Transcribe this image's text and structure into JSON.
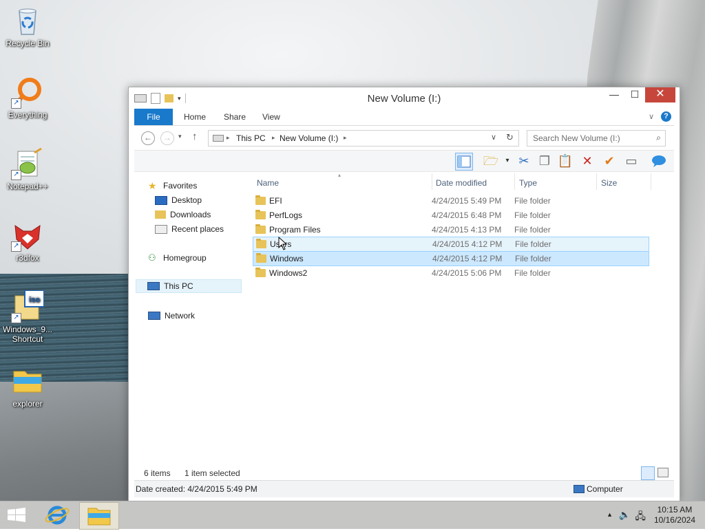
{
  "desktop": {
    "icons": [
      {
        "label": "Recycle Bin",
        "icon": "recycle-bin-icon"
      },
      {
        "label": "Everything",
        "icon": "everything-icon"
      },
      {
        "label": "Notepad++",
        "icon": "notepad-plus-plus-icon"
      },
      {
        "label": "r3dfox",
        "icon": "r3dfox-icon"
      },
      {
        "label_line1": "Windows_9...",
        "label_line2": "Shortcut",
        "icon": "iso-file-icon"
      },
      {
        "label": "explorer",
        "icon": "folder-icon"
      }
    ]
  },
  "window": {
    "title": "New Volume (I:)",
    "tabs": [
      "File",
      "Home",
      "Share",
      "View"
    ],
    "address": {
      "segments": [
        "This PC",
        "New Volume (I:)"
      ]
    },
    "search": {
      "placeholder": "Search New Volume (I:)"
    },
    "nav": {
      "favorites": "Favorites",
      "favorites_items": [
        "Desktop",
        "Downloads",
        "Recent places"
      ],
      "homegroup": "Homegroup",
      "this_pc": "This PC",
      "network": "Network"
    },
    "columns": {
      "name": "Name",
      "date": "Date modified",
      "type": "Type",
      "size": "Size"
    },
    "files": [
      {
        "name": "EFI",
        "date": "4/24/2015 5:49 PM",
        "type": "File folder"
      },
      {
        "name": "PerfLogs",
        "date": "4/24/2015 6:48 PM",
        "type": "File folder"
      },
      {
        "name": "Program Files",
        "date": "4/24/2015 4:13 PM",
        "type": "File folder"
      },
      {
        "name": "Users",
        "date": "4/24/2015 4:12 PM",
        "type": "File folder"
      },
      {
        "name": "Windows",
        "date": "4/24/2015 4:12 PM",
        "type": "File folder"
      },
      {
        "name": "Windows2",
        "date": "4/24/2015 5:06 PM",
        "type": "File folder"
      }
    ],
    "status": {
      "items": "6 items",
      "selected": "1 item selected"
    },
    "details": {
      "date_created": "Date created: 4/24/2015 5:49 PM",
      "location": "Computer"
    }
  },
  "taskbar": {
    "clock_time": "10:15 AM",
    "clock_date": "10/16/2024"
  },
  "colors": {
    "accent": "#1979ca",
    "selection": "#cce8ff",
    "close_button": "#c7463c"
  }
}
